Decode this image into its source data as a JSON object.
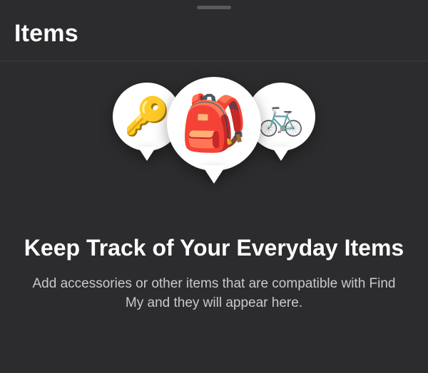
{
  "header": {
    "title": "Items"
  },
  "illustration": {
    "left_icon": "🔑",
    "center_icon": "🎒",
    "right_icon": "🚲"
  },
  "empty_state": {
    "headline": "Keep Track of Your Everyday Items",
    "subtext": "Add accessories or other items that are compatible with Find My and they will appear here."
  }
}
